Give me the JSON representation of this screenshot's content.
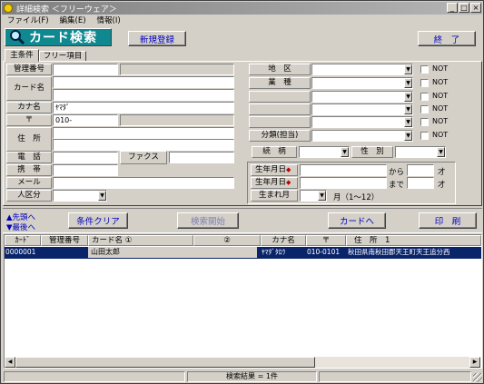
{
  "window": {
    "title": "詳細検索 ＜フリーウェア＞"
  },
  "menu": [
    "ファイル(F)",
    "編集(E)",
    "情報(I)"
  ],
  "toolbar": {
    "header_label": "カード検索",
    "new_button": "新規登録",
    "close_button": "終　了"
  },
  "tabs": [
    "主条件",
    "フリー項目"
  ],
  "left_form": {
    "kanri_label": "管理番号",
    "card_name_label": "カード名",
    "kana_label": "カナ名",
    "kana_value": "ﾔﾏﾀﾞ",
    "postal_label": "〒",
    "postal_value": "010-",
    "address_label": "住　所",
    "phone_label": "電　話",
    "fax_label": "ファクス",
    "mobile_label": "携　帯",
    "mail_label": "メール",
    "category_label": "人区分"
  },
  "right_form": {
    "district_label": "地　区",
    "industry_label": "業　種",
    "assign_label": "分類(担当)",
    "not_label": "NOT",
    "relation_label": "続　柄",
    "sex_label": "性　別",
    "birth1_label": "生年月日",
    "birth2_label": "生年月日",
    "from_label": "から",
    "until_label": "まで",
    "age_unit": "才",
    "birth_month_label": "生まれ月",
    "month_hint": "月（1〜12）"
  },
  "actions": {
    "nav_first": "▲先頭へ",
    "nav_last": "▼最後へ",
    "clear": "条件クリア",
    "search": "検索開始",
    "to_card": "カードへ",
    "print": "印　刷"
  },
  "grid": {
    "headers": [
      "ｶｰﾄﾞ",
      "管理番号",
      "カード名 ①",
      "②",
      "カナ名",
      "〒",
      "住　所　1"
    ],
    "rows": [
      {
        "card": "0000001",
        "kanri": "",
        "name1": "山田太郎",
        "name2": "",
        "kana": "ﾔﾏﾀﾞﾀﾛｳ",
        "postal": "010-0101",
        "address": "秋田県南秋田郡天王町天王追分西"
      }
    ]
  },
  "status": {
    "result": "検索結果 = 1件"
  }
}
